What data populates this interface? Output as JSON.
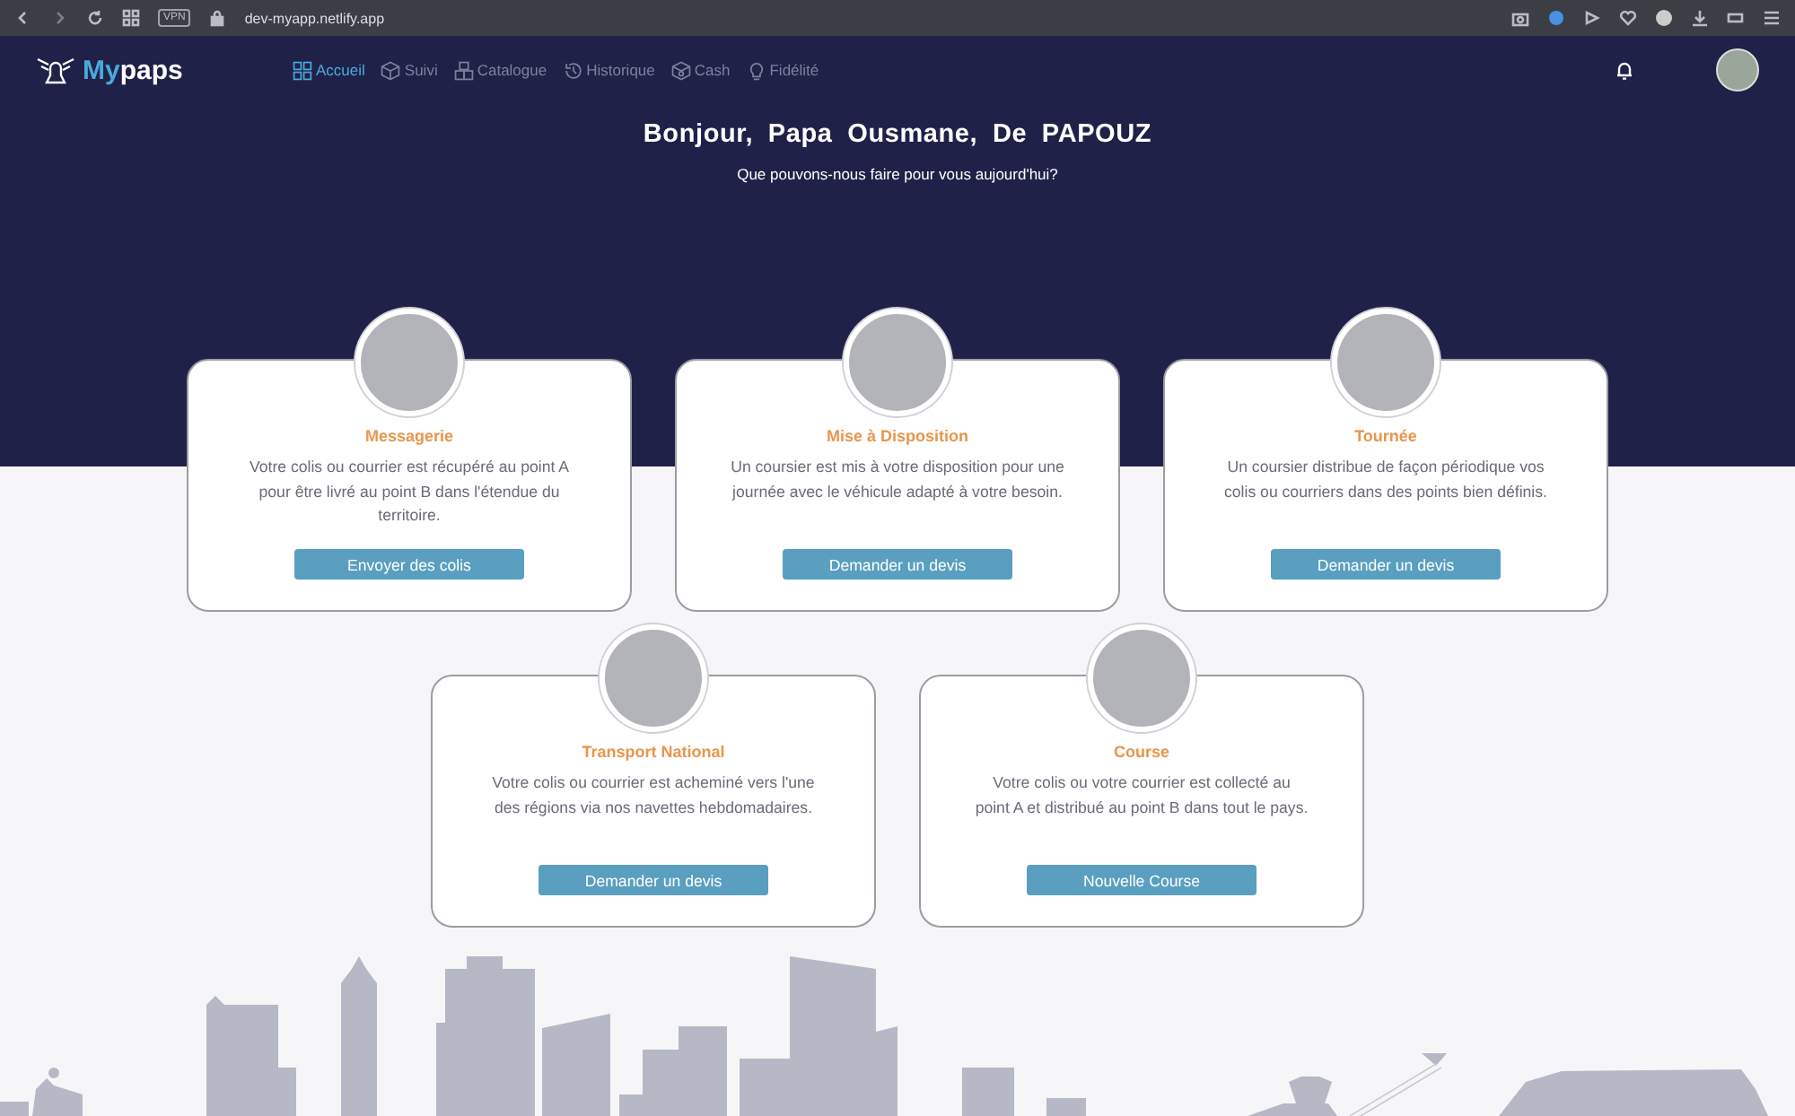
{
  "browser": {
    "vpn_label": "VPN",
    "url": "dev-myapp.netlify.app"
  },
  "nav": {
    "logo_prefix": "My",
    "logo_suffix": "paps",
    "items": [
      {
        "label": "Accueil",
        "selected": true
      },
      {
        "label": "Suivi",
        "selected": false
      },
      {
        "label": "Catalogue",
        "selected": false
      },
      {
        "label": "Historique",
        "selected": false
      },
      {
        "label": "Cash",
        "selected": false
      },
      {
        "label": "Fidélité",
        "selected": false
      }
    ]
  },
  "greeting": "Bonjour, Papa Ousmane, De PAPOUZ",
  "subtitle": "Que pouvons-nous faire pour vous aujourd'hui?",
  "services": [
    {
      "title": "Messagerie",
      "description": "Votre colis ou courrier est récupéré au point A pour être livré au point B dans l'étendue du territoire.",
      "button": "Envoyer des colis"
    },
    {
      "title": "Mise à Disposition",
      "description": "Un coursier est mis à votre disposition pour une journée avec le véhicule adapté à votre besoin.",
      "button": "Demander un devis"
    },
    {
      "title": "Tournée",
      "description": "Un coursier distribue de façon périodique vos colis ou courriers dans des points bien définis.",
      "button": "Demander un devis"
    },
    {
      "title": "Transport National",
      "description": "Votre colis ou courrier est acheminé vers l'une des régions via nos navettes hebdomadaires.",
      "button": "Demander un devis"
    },
    {
      "title": "Course",
      "description": "Votre colis ou votre courrier est collecté au point A et distribué au point B dans tout le pays.",
      "button": "Nouvelle Course"
    }
  ]
}
